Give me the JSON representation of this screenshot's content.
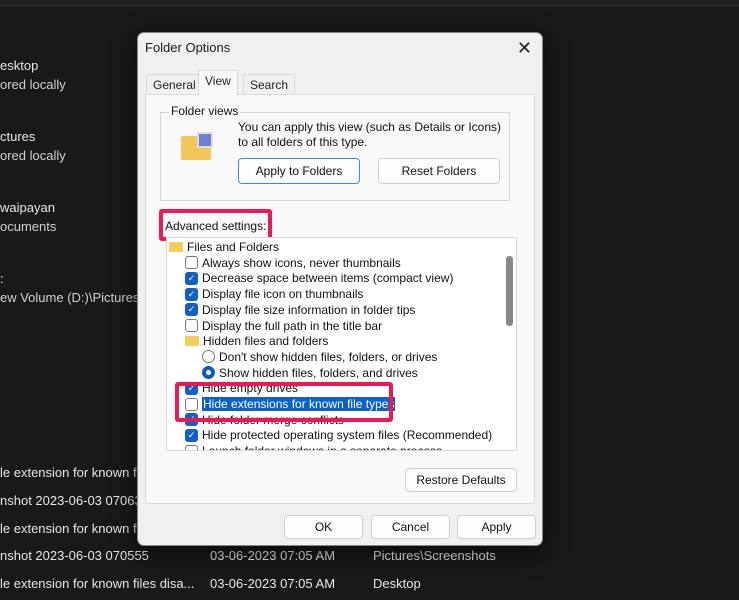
{
  "background": {
    "rows": [
      {
        "name": "esktop",
        "sub": "ored locally"
      },
      {
        "name": "ctures",
        "sub": "ored locally"
      },
      {
        "name": "waipayan",
        "sub": "ocuments"
      },
      {
        "name": ":",
        "sub": "ew Volume (D:)\\Pictures"
      }
    ],
    "files": [
      {
        "name": "le extension for known f",
        "date": "",
        "location": ""
      },
      {
        "name": "nshot 2023-06-03 07063",
        "date": "",
        "location": ""
      },
      {
        "name": "le extension for known f",
        "date": "",
        "location": ""
      },
      {
        "name": "nshot 2023-06-03 070555",
        "date": "03-06-2023 07:05 AM",
        "location": "Pictures\\Screenshots"
      },
      {
        "name": "le extension for known files disa...",
        "date": "03-06-2023 07:05 AM",
        "location": "Desktop"
      }
    ]
  },
  "dialog": {
    "title": "Folder Options",
    "tabs": [
      {
        "label": "General"
      },
      {
        "label": "View",
        "active": true
      },
      {
        "label": "Search"
      }
    ],
    "folder_views": {
      "label": "Folder views",
      "description": "You can apply this view (such as Details or Icons) to all folders of this type.",
      "apply_label": "Apply to Folders",
      "reset_label": "Reset Folders"
    },
    "advanced_label": "Advanced settings:",
    "items": [
      {
        "type": "folder",
        "label": "Files and Folders",
        "indent": 0
      },
      {
        "type": "checkbox",
        "label": "Always show icons, never thumbnails",
        "checked": false,
        "indent": 1
      },
      {
        "type": "checkbox",
        "label": "Decrease space between items (compact view)",
        "checked": true,
        "indent": 1
      },
      {
        "type": "checkbox",
        "label": "Display file icon on thumbnails",
        "checked": true,
        "indent": 1
      },
      {
        "type": "checkbox",
        "label": "Display file size information in folder tips",
        "checked": true,
        "indent": 1
      },
      {
        "type": "checkbox",
        "label": "Display the full path in the title bar",
        "checked": false,
        "indent": 1
      },
      {
        "type": "folder",
        "label": "Hidden files and folders",
        "indent": 1
      },
      {
        "type": "radio",
        "label": "Don't show hidden files, folders, or drives",
        "checked": false,
        "indent": 2
      },
      {
        "type": "radio",
        "label": "Show hidden files, folders, and drives",
        "checked": true,
        "indent": 2
      },
      {
        "type": "checkbox",
        "label": "Hide empty drives",
        "checked": true,
        "indent": 1
      },
      {
        "type": "checkbox",
        "label": "Hide extensions for known file types",
        "checked": false,
        "indent": 1,
        "selected": true
      },
      {
        "type": "checkbox",
        "label": "Hide folder merge conflicts",
        "checked": true,
        "indent": 1
      },
      {
        "type": "checkbox",
        "label": "Hide protected operating system files (Recommended)",
        "checked": true,
        "indent": 1
      },
      {
        "type": "checkbox",
        "label": "Launch folder windows in a separate process",
        "checked": false,
        "indent": 1
      }
    ],
    "restore_label": "Restore Defaults",
    "ok_label": "OK",
    "cancel_label": "Cancel",
    "apply_label": "Apply"
  },
  "colors": {
    "highlight": "#ee1857",
    "accent": "#1160c2"
  }
}
